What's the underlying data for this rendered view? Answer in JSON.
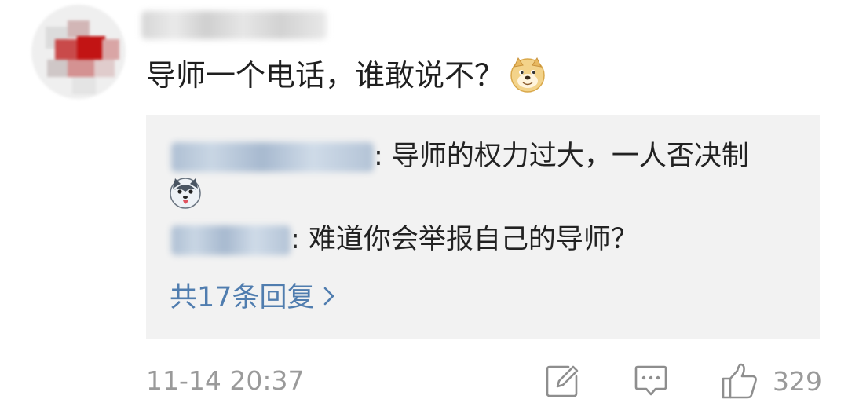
{
  "comment": {
    "text": "导师一个电话，谁敢说不？",
    "emoji": "doge-emoji"
  },
  "replies": [
    {
      "text": ": 导师的权力过大，一人否决制",
      "emoji": "husky-tongue-emoji"
    },
    {
      "text": ": 难道你会举报自己的导师？"
    }
  ],
  "more_replies": {
    "label": "共17条回复",
    "icon": "chevron-right-icon"
  },
  "footer": {
    "timestamp": "11-14 20:37",
    "share_icon": "edit-share-icon",
    "comment_icon": "comment-bubble-icon",
    "like_icon": "thumbs-up-icon",
    "like_count": "329"
  },
  "colors": {
    "link_blue": "#507daf",
    "meta_gray": "#9a9a9a",
    "reply_bg": "#f2f2f2"
  }
}
